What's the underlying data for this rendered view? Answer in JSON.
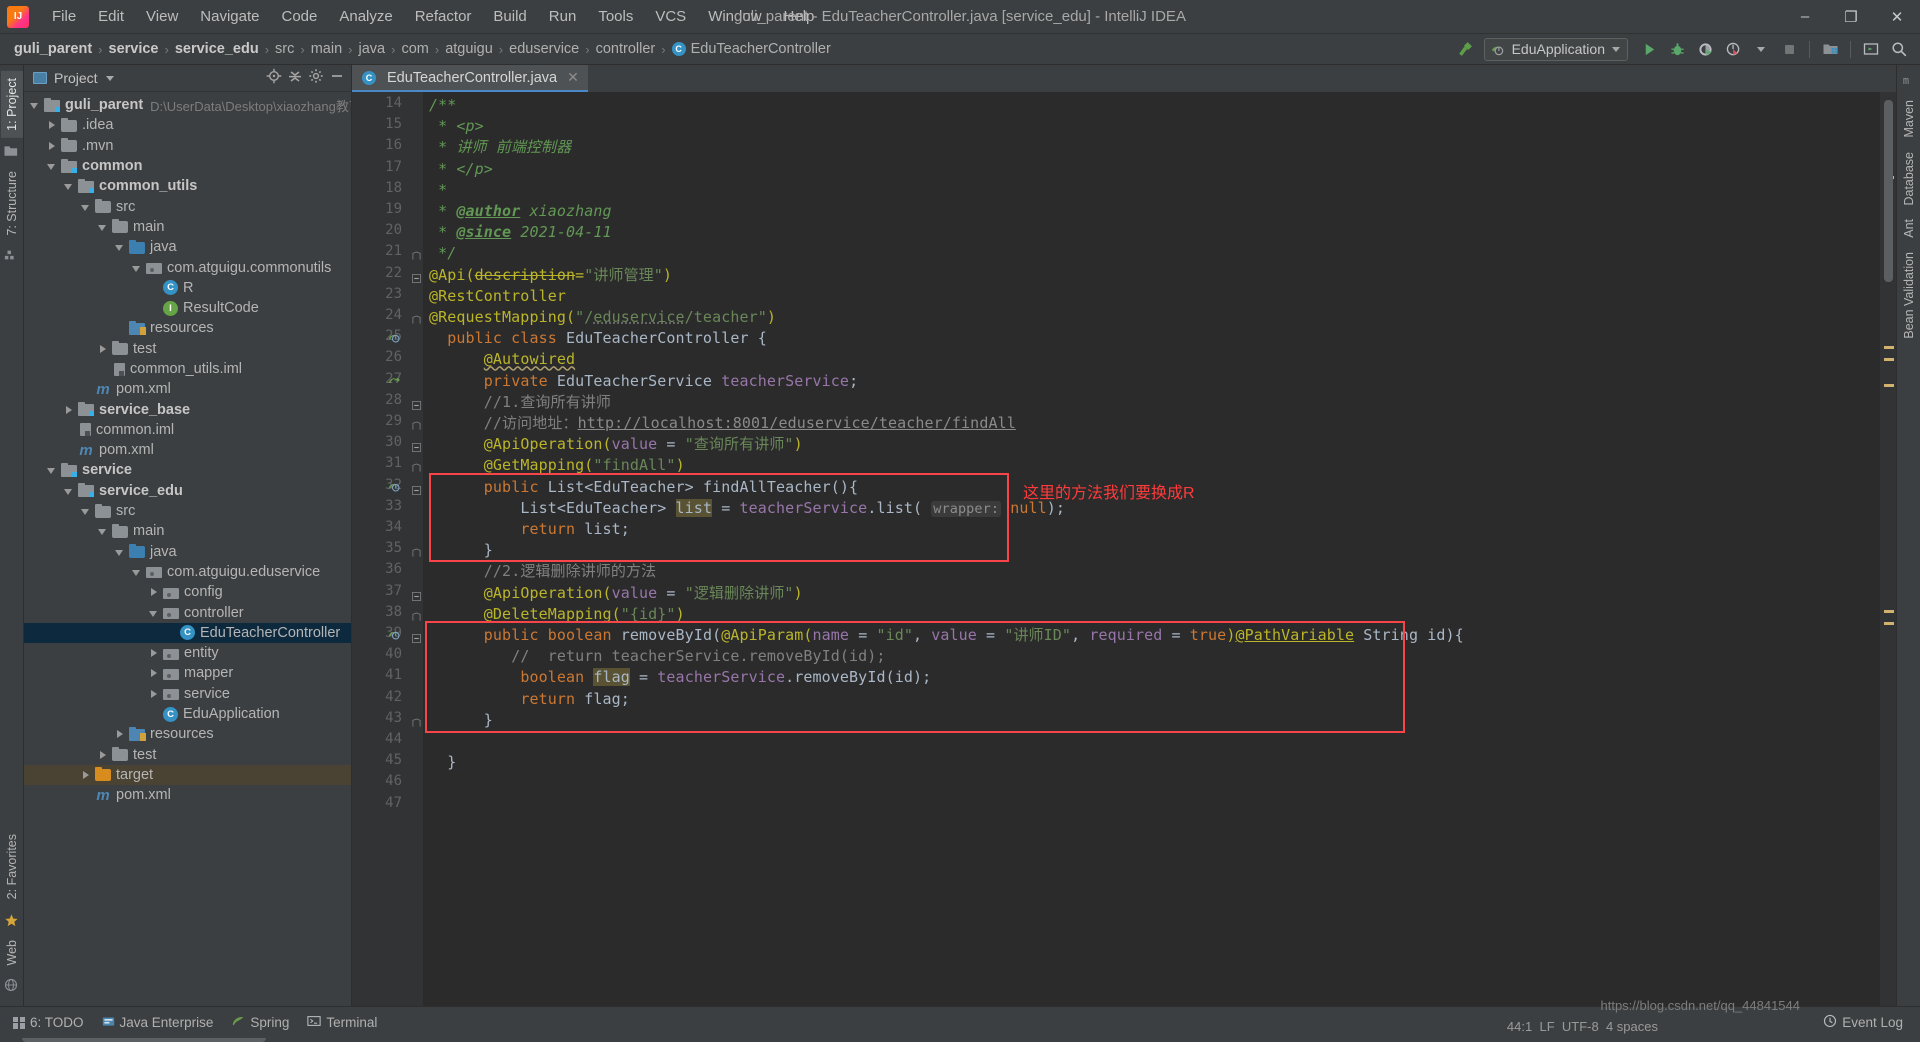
{
  "titlebar": {
    "app_icon": "intellij-logo",
    "menus": [
      "File",
      "Edit",
      "View",
      "Navigate",
      "Code",
      "Analyze",
      "Refactor",
      "Build",
      "Run",
      "Tools",
      "VCS",
      "Window",
      "Help"
    ],
    "window_title": "guli_parent - EduTeacherController.java [service_edu] - IntelliJ IDEA",
    "minimize": "–",
    "maximize": "❐",
    "close": "✕"
  },
  "navbar": {
    "breadcrumbs": [
      "guli_parent",
      "service",
      "service_edu",
      "src",
      "main",
      "java",
      "com",
      "atguigu",
      "eduservice",
      "controller"
    ],
    "breadcrumb_file": "EduTeacherController",
    "breadcrumb_file_badge": "C",
    "separator": "›",
    "run_config": "EduApplication",
    "icons": [
      "hammer-icon",
      "run-icon",
      "debug-icon",
      "run-with-coverage-icon",
      "profiler-icon",
      "stop-icon",
      "project-structure-icon",
      "terminal-icon",
      "search-everywhere-icon"
    ]
  },
  "left_strip": {
    "tabs": [
      "1: Project",
      "7: Structure",
      "2: Favorites",
      "Web"
    ],
    "icons": [
      "folder-icon",
      "structure-icon",
      "star-icon",
      "web-icon"
    ]
  },
  "right_strip": {
    "tabs": [
      "Maven",
      "Database",
      "Ant",
      "Bean Validation"
    ],
    "icon": "m-icon"
  },
  "project_panel": {
    "title": "Project",
    "header_icons": [
      "locate-icon",
      "collapse-all-icon",
      "settings-icon",
      "hide-icon"
    ],
    "tree": [
      {
        "depth": 0,
        "arrow": "down",
        "icon": "module",
        "label": "guli_parent",
        "bold": true,
        "path": "D:\\UserData\\Desktop\\xiaozhang教育"
      },
      {
        "depth": 1,
        "arrow": "right",
        "icon": "folder",
        "label": ".idea",
        "bold": false,
        "path": ""
      },
      {
        "depth": 1,
        "arrow": "right",
        "icon": "folder",
        "label": ".mvn",
        "bold": false,
        "path": ""
      },
      {
        "depth": 1,
        "arrow": "down",
        "icon": "module",
        "label": "common",
        "bold": true,
        "path": ""
      },
      {
        "depth": 2,
        "arrow": "down",
        "icon": "module",
        "label": "common_utils",
        "bold": true,
        "path": ""
      },
      {
        "depth": 3,
        "arrow": "down",
        "icon": "folder",
        "label": "src",
        "bold": false,
        "path": ""
      },
      {
        "depth": 4,
        "arrow": "down",
        "icon": "folder",
        "label": "main",
        "bold": false,
        "path": ""
      },
      {
        "depth": 5,
        "arrow": "down",
        "icon": "srcroot",
        "label": "java",
        "bold": false,
        "path": ""
      },
      {
        "depth": 6,
        "arrow": "down",
        "icon": "package",
        "label": "com.atguigu.commonutils",
        "bold": false,
        "path": ""
      },
      {
        "depth": 7,
        "arrow": "none",
        "icon": "class",
        "label": "R",
        "bold": false,
        "path": ""
      },
      {
        "depth": 7,
        "arrow": "none",
        "icon": "iface",
        "label": "ResultCode",
        "bold": false,
        "path": ""
      },
      {
        "depth": 5,
        "arrow": "none",
        "icon": "resroot",
        "label": "resources",
        "bold": false,
        "path": ""
      },
      {
        "depth": 4,
        "arrow": "right",
        "icon": "folder",
        "label": "test",
        "bold": false,
        "path": ""
      },
      {
        "depth": 4,
        "arrow": "none",
        "icon": "iml",
        "label": "common_utils.iml",
        "bold": false,
        "path": ""
      },
      {
        "depth": 3,
        "arrow": "none",
        "icon": "maven",
        "label": "pom.xml",
        "bold": false,
        "path": ""
      },
      {
        "depth": 2,
        "arrow": "right",
        "icon": "module",
        "label": "service_base",
        "bold": true,
        "path": ""
      },
      {
        "depth": 2,
        "arrow": "none",
        "icon": "iml",
        "label": "common.iml",
        "bold": false,
        "path": ""
      },
      {
        "depth": 2,
        "arrow": "none",
        "icon": "maven",
        "label": "pom.xml",
        "bold": false,
        "path": ""
      },
      {
        "depth": 1,
        "arrow": "down",
        "icon": "module",
        "label": "service",
        "bold": true,
        "path": ""
      },
      {
        "depth": 2,
        "arrow": "down",
        "icon": "module",
        "label": "service_edu",
        "bold": true,
        "path": ""
      },
      {
        "depth": 3,
        "arrow": "down",
        "icon": "folder",
        "label": "src",
        "bold": false,
        "path": ""
      },
      {
        "depth": 4,
        "arrow": "down",
        "icon": "folder",
        "label": "main",
        "bold": false,
        "path": ""
      },
      {
        "depth": 5,
        "arrow": "down",
        "icon": "srcroot",
        "label": "java",
        "bold": false,
        "path": ""
      },
      {
        "depth": 6,
        "arrow": "down",
        "icon": "package",
        "label": "com.atguigu.eduservice",
        "bold": false,
        "path": ""
      },
      {
        "depth": 7,
        "arrow": "right",
        "icon": "package",
        "label": "config",
        "bold": false,
        "path": ""
      },
      {
        "depth": 7,
        "arrow": "down",
        "icon": "package",
        "label": "controller",
        "bold": false,
        "path": ""
      },
      {
        "depth": 8,
        "arrow": "none",
        "icon": "class",
        "label": "EduTeacherController",
        "bold": false,
        "path": "",
        "selected": true
      },
      {
        "depth": 7,
        "arrow": "right",
        "icon": "package",
        "label": "entity",
        "bold": false,
        "path": ""
      },
      {
        "depth": 7,
        "arrow": "right",
        "icon": "package",
        "label": "mapper",
        "bold": false,
        "path": ""
      },
      {
        "depth": 7,
        "arrow": "right",
        "icon": "package",
        "label": "service",
        "bold": false,
        "path": ""
      },
      {
        "depth": 7,
        "arrow": "none",
        "icon": "class",
        "label": "EduApplication",
        "bold": false,
        "path": ""
      },
      {
        "depth": 5,
        "arrow": "right",
        "icon": "resroot",
        "label": "resources",
        "bold": false,
        "path": ""
      },
      {
        "depth": 4,
        "arrow": "right",
        "icon": "folder",
        "label": "test",
        "bold": false,
        "path": ""
      },
      {
        "depth": 3,
        "arrow": "right",
        "icon": "target",
        "label": "target",
        "bold": false,
        "path": "",
        "highlight": true
      },
      {
        "depth": 3,
        "arrow": "none",
        "icon": "maven",
        "label": "pom.xml",
        "bold": false,
        "path": ""
      }
    ]
  },
  "editor": {
    "tab": {
      "label": "EduTeacherController.java",
      "badge": "C",
      "close": "✕"
    },
    "first_line_number": 14,
    "lines": [
      {
        "n": 14,
        "text": "/**"
      },
      {
        "n": 15,
        "text": " * <p>"
      },
      {
        "n": 16,
        "text": " * 讲师 前端控制器"
      },
      {
        "n": 17,
        "text": " * </p>"
      },
      {
        "n": 18,
        "text": " *"
      },
      {
        "n": 19,
        "text": " * @author xiaozhang"
      },
      {
        "n": 20,
        "text": " * @since 2021-04-11"
      },
      {
        "n": 21,
        "text": " */"
      },
      {
        "n": 22,
        "text": "@Api(description=\"讲师管理\")"
      },
      {
        "n": 23,
        "text": "@RestController"
      },
      {
        "n": 24,
        "text": "@RequestMapping(\"/eduservice/teacher\")"
      },
      {
        "n": 25,
        "text": "public class EduTeacherController {"
      },
      {
        "n": 26,
        "text": "    @Autowired"
      },
      {
        "n": 27,
        "text": "    private EduTeacherService teacherService;"
      },
      {
        "n": 28,
        "text": "    //1.查询所有讲师"
      },
      {
        "n": 29,
        "text": "    //访问地址：http://localhost:8001/eduservice/teacher/findAll"
      },
      {
        "n": 30,
        "text": "    @ApiOperation(value = \"查询所有讲师\")"
      },
      {
        "n": 31,
        "text": "    @GetMapping(\"findAll\")"
      },
      {
        "n": 32,
        "text": "    public List<EduTeacher> findAllTeacher(){"
      },
      {
        "n": 33,
        "text": "        List<EduTeacher> list = teacherService.list( wrapper: null);"
      },
      {
        "n": 34,
        "text": "        return list;"
      },
      {
        "n": 35,
        "text": "    }"
      },
      {
        "n": 36,
        "text": "    //2.逻辑删除讲师的方法"
      },
      {
        "n": 37,
        "text": "    @ApiOperation(value = \"逻辑删除讲师\")"
      },
      {
        "n": 38,
        "text": "    @DeleteMapping(\"{id}\")"
      },
      {
        "n": 39,
        "text": "    public boolean removeById(@ApiParam(name = \"id\", value = \"讲师ID\", required = true)@PathVariable String id){"
      },
      {
        "n": 40,
        "text": "       //  return teacherService.removeById(id);"
      },
      {
        "n": 41,
        "text": "        boolean flag = teacherService.removeById(id);"
      },
      {
        "n": 42,
        "text": "        return flag;"
      },
      {
        "n": 43,
        "text": "    }"
      },
      {
        "n": 44,
        "text": ""
      },
      {
        "n": 45,
        "text": "}"
      },
      {
        "n": 46,
        "text": ""
      },
      {
        "n": 47,
        "text": ""
      }
    ],
    "annotation_red": "这里的方法我们要换成R",
    "inlay_hint": "wrapper:"
  },
  "statusbar": {
    "items": [
      {
        "icon": "todo-icon",
        "label": "6: TODO"
      },
      {
        "icon": "java-enterprise-icon",
        "label": "Java Enterprise"
      },
      {
        "icon": "spring-icon",
        "label": "Spring"
      },
      {
        "icon": "terminal-icon",
        "label": "Terminal"
      }
    ],
    "event_log": "Event Log",
    "caret_position": "44:1",
    "line_separator": "LF",
    "encoding": "UTF-8",
    "indent": "4 spaces",
    "watermark": "https://blog.csdn.net/qq_44841544"
  }
}
